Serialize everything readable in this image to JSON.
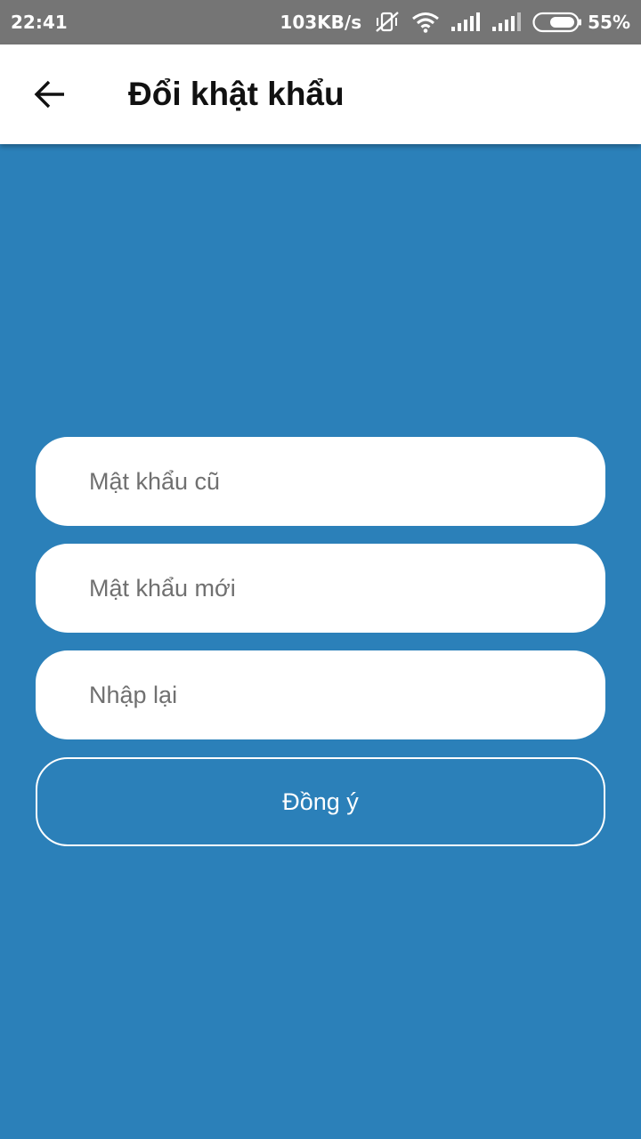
{
  "status_bar": {
    "time": "22:41",
    "network_speed": "103KB/s",
    "battery_percent": "55%",
    "icons": [
      "vibrate-off-icon",
      "wifi-icon",
      "signal-icon",
      "signal-icon",
      "battery-icon"
    ],
    "background_color": "#757575"
  },
  "app_bar": {
    "title": "Đổi khật khẩu",
    "back_icon": "arrow-left-icon",
    "background_color": "#ffffff"
  },
  "form": {
    "old_password_placeholder": "Mật khẩu cũ",
    "new_password_placeholder": "Mật khẩu mới",
    "confirm_password_placeholder": "Nhập lại",
    "submit_label": "Đồng ý"
  },
  "colors": {
    "background": "#2b80b9",
    "field_background": "#ffffff",
    "placeholder_text": "#707070",
    "button_border": "#ffffff"
  }
}
